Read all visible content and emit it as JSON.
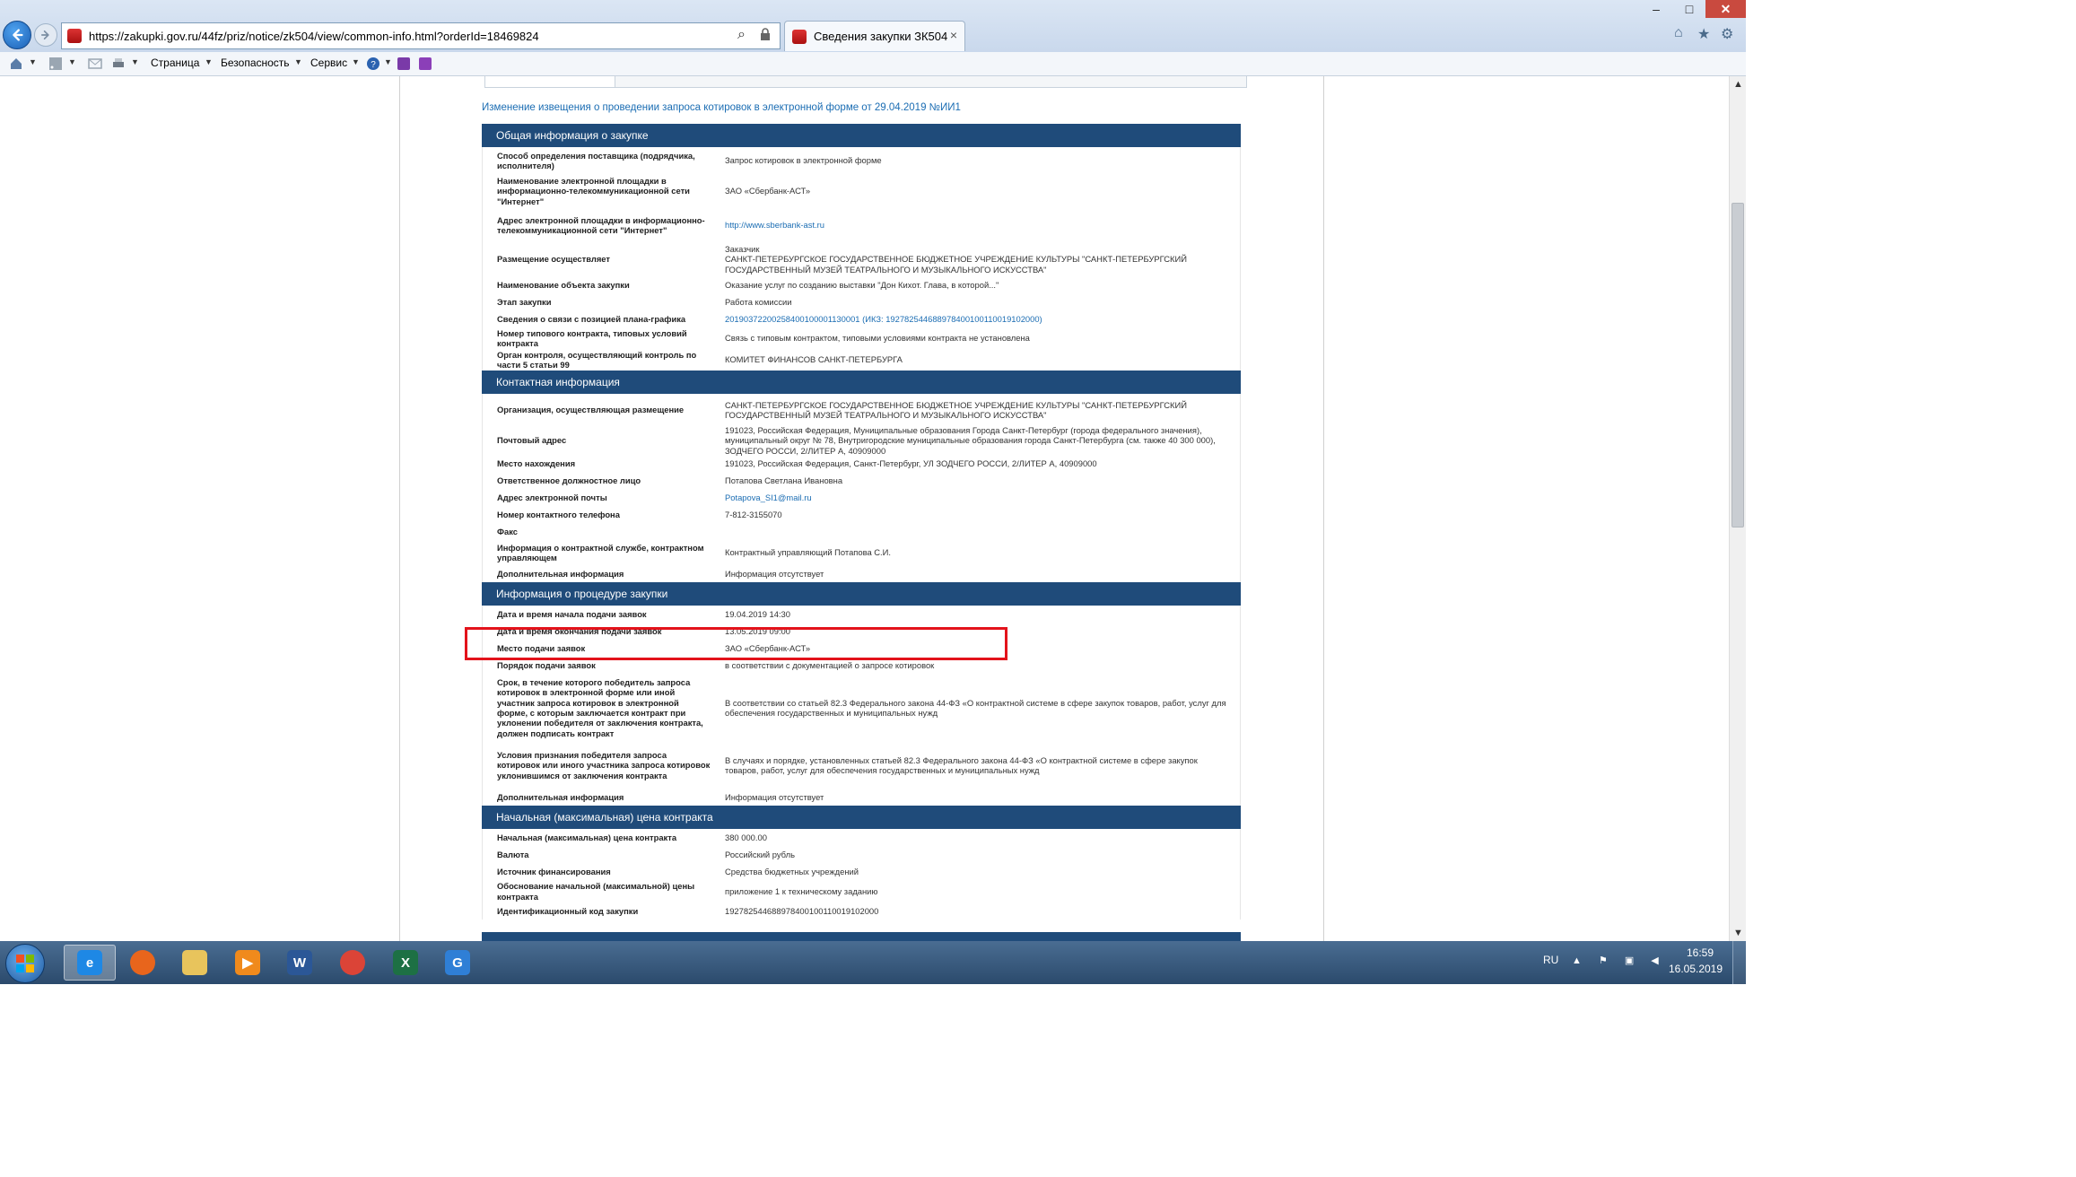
{
  "browser": {
    "url": "https://zakupki.gov.ru/44fz/priz/notice/zk504/view/common-info.html?orderId=18469824",
    "tab_title": "Сведения закупки ЗК504",
    "tab_close": "×",
    "window_controls": {
      "minimize": "–",
      "maximize": "□",
      "close": "✕"
    },
    "toolbar_icons": [
      "home-icon",
      "star-icon",
      "gear-icon"
    ]
  },
  "command_bar": {
    "page": "Страница",
    "security": "Безопасность",
    "service": "Сервис"
  },
  "notice_title": "Изменение извещения о проведении запроса котировок в электронной форме от 29.04.2019 №ИИ1",
  "sections": [
    {
      "title": "Общая информация о закупке",
      "rows": [
        {
          "label": "Способ определения поставщика (подрядчика, исполнителя)",
          "value": "Запрос котировок в электронной форме"
        },
        {
          "label": "Наименование электронной площадки в информационно-телекоммуникационной сети \"Интернет\"",
          "value": "ЗАО «Сбербанк-АСТ»"
        },
        {
          "label": "Адрес электронной площадки в информационно-телекоммуникационной сети \"Интернет\"",
          "value": "http://www.sberbank-ast.ru",
          "link": true
        },
        {
          "label": "Размещение осуществляет",
          "value": "Заказчик\nСАНКТ-ПЕТЕРБУРГСКОЕ ГОСУДАРСТВЕННОЕ БЮДЖЕТНОЕ УЧРЕЖДЕНИЕ КУЛЬТУРЫ \"САНКТ-ПЕТЕРБУРГСКИЙ ГОСУДАРСТВЕННЫЙ МУЗЕЙ ТЕАТРАЛЬНОГО И МУЗЫКАЛЬНОГО ИСКУССТВА\""
        },
        {
          "label": "Наименование объекта закупки",
          "value": "Оказание услуг по созданию выставки \"Дон Кихот. Глава, в которой...\""
        },
        {
          "label": "Этап закупки",
          "value": "Работа комиссии"
        },
        {
          "label": "Сведения о связи с позицией плана-графика",
          "value": "20190372200258400100001130001 (ИКЗ: 192782544688978400100110019102000)",
          "link": true
        },
        {
          "label": "Номер типового контракта, типовых условий контракта",
          "value": "Связь с типовым контрактом, типовыми условиями контракта не установлена"
        },
        {
          "label": "Орган контроля, осуществляющий контроль по части 5 статьи 99",
          "value": "КОМИТЕТ ФИНАНСОВ САНКТ-ПЕТЕРБУРГА"
        }
      ]
    },
    {
      "title": "Контактная информация",
      "rows": [
        {
          "label": "Организация, осуществляющая размещение",
          "value": "САНКТ-ПЕТЕРБУРГСКОЕ ГОСУДАРСТВЕННОЕ БЮДЖЕТНОЕ УЧРЕЖДЕНИЕ КУЛЬТУРЫ \"САНКТ-ПЕТЕРБУРГСКИЙ ГОСУДАРСТВЕННЫЙ МУЗЕЙ ТЕАТРАЛЬНОГО И МУЗЫКАЛЬНОГО ИСКУССТВА\""
        },
        {
          "label": "Почтовый адрес",
          "value": "191023, Российская Федерация, Муниципальные образования Города Санкт-Петербург (города федерального значения), муниципальный округ № 78, Внутригородские муниципальные образования города Санкт-Петербурга (см. также 40 300 000), ЗОДЧЕГО РОССИ, 2/ЛИТЕР А, 40909000"
        },
        {
          "label": "Место нахождения",
          "value": "191023, Российская Федерация, Санкт-Петербург, УЛ ЗОДЧЕГО РОССИ, 2/ЛИТЕР А, 40909000"
        },
        {
          "label": "Ответственное должностное лицо",
          "value": "Потапова Светлана Ивановна"
        },
        {
          "label": "Адрес электронной почты",
          "value": "Potapova_SI1@mail.ru",
          "link": true
        },
        {
          "label": "Номер контактного телефона",
          "value": "7-812-3155070"
        },
        {
          "label": "Факс",
          "value": ""
        },
        {
          "label": "Информация о контрактной службе, контрактном управляющем",
          "value": "Контрактный управляющий Потапова С.И."
        },
        {
          "label": "Дополнительная информация",
          "value": "Информация отсутствует"
        }
      ]
    },
    {
      "title": "Информация о процедуре закупки",
      "rows": [
        {
          "label": "Дата и время начала подачи заявок",
          "value": "19.04.2019 14:30"
        },
        {
          "label": "Дата и время окончания подачи заявок",
          "value": "13.05.2019 09:00"
        },
        {
          "label": "Место подачи заявок",
          "value": "ЗАО «Сбербанк-АСТ»"
        },
        {
          "label": "Порядок подачи заявок",
          "value": "в соответствии с документацией о запросе котировок"
        },
        {
          "label": "Срок, в течение которого победитель запроса котировок в электронной форме или иной участник запроса котировок в электронной форме, с которым заключается контракт при уклонении победителя от заключения контракта, должен подписать контракт",
          "value": "В соответствии со статьей 82.3 Федерального закона 44-ФЗ «О контрактной системе в сфере закупок товаров, работ, услуг для обеспечения государственных и муниципальных нужд"
        },
        {
          "label": "Условия признания победителя запроса котировок или иного участника запроса котировок уклонившимся от заключения контракта",
          "value": "В случаях и порядке, установленных статьей 82.3 Федерального закона 44-ФЗ «О контрактной системе в сфере закупок товаров, работ, услуг для обеспечения государственных и муниципальных нужд"
        },
        {
          "label": "Дополнительная информация",
          "value": "Информация отсутствует"
        }
      ]
    },
    {
      "title": "Начальная (максимальная) цена контракта",
      "rows": [
        {
          "label": "Начальная (максимальная) цена контракта",
          "value": "380 000.00"
        },
        {
          "label": "Валюта",
          "value": "Российский рубль"
        },
        {
          "label": "Источник финансирования",
          "value": "Средства бюджетных учреждений"
        },
        {
          "label": "Обоснование начальной (максимальной) цены контракта",
          "value": "приложение 1 к техническому заданию"
        },
        {
          "label": "Идентификационный код закупки",
          "value": "192782544688978400100110019102000"
        }
      ]
    }
  ],
  "taskbar": {
    "lang": "RU",
    "time": "16:59",
    "date": "16.05.2019",
    "apps": [
      "internet-explorer-icon",
      "firefox-icon",
      "file-explorer-icon",
      "media-player-icon",
      "word-icon",
      "chrome-icon",
      "excel-icon",
      "sync-app-icon"
    ]
  }
}
